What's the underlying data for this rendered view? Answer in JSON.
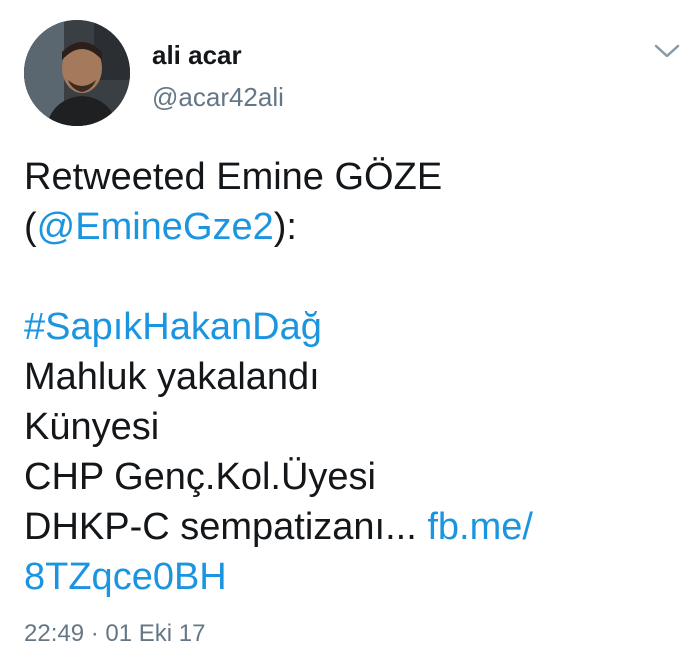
{
  "user": {
    "name": "ali acar",
    "handle": "@acar42ali"
  },
  "menu_icon": "chevron-down-icon",
  "tweet": {
    "line1": "Retweeted Emine GÖZE",
    "paren_open": "(",
    "mention": "@EmineGze2",
    "paren_close": "):",
    "hashtag": "#SapıkHakanDağ",
    "line3": "Mahluk yakalandı",
    "line4": "Künyesi",
    "line5": "CHP Genç.Kol.Üyesi",
    "line6": "DHKP-C sempatizanı... ",
    "link_part1": "fb.me/",
    "link_part2": "8TZqce0BH"
  },
  "timestamp": "22:49 · 01 Eki 17",
  "colors": {
    "link": "#1b95e0",
    "secondary": "#657786",
    "text": "#14171a"
  }
}
